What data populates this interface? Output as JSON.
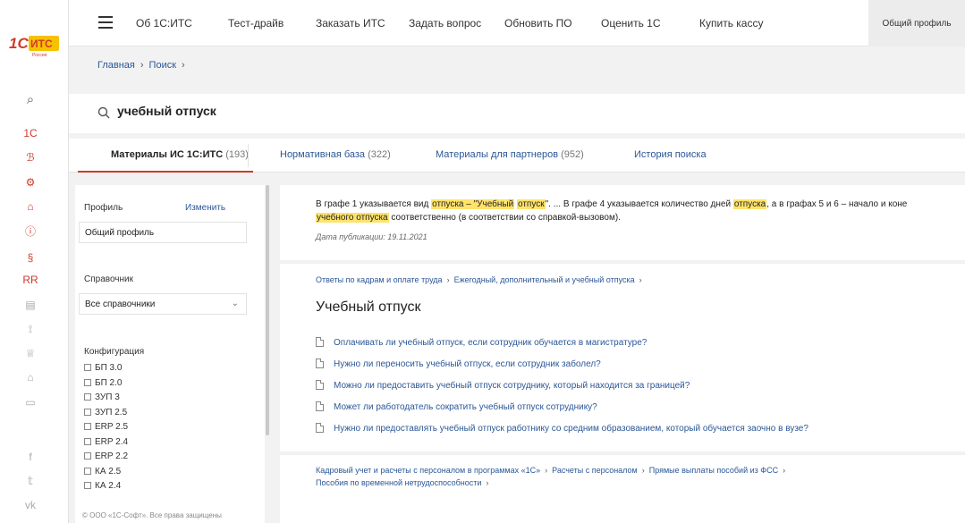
{
  "brand": {
    "logo_text": "1С:ИТС",
    "logo_sub": "Россия",
    "color": "#d03a2c"
  },
  "rail_icons": [
    "search-icon",
    "1c-icon",
    "shield-icon",
    "gears-icon",
    "library-icon",
    "info-icon",
    "paragraph-icon",
    "people-icon",
    "document-icon",
    "megaphone-icon",
    "trophy-icon",
    "graduation-cap-icon",
    "chat-icon",
    "facebook-icon",
    "twitter-icon",
    "vk-icon"
  ],
  "rail_glyphs": [
    "⌕",
    "1С",
    "ℬ",
    "⚙",
    "⌂",
    "ⓘ",
    "§",
    "RR",
    "▤",
    "⟟",
    "♕",
    "⌂",
    "▭",
    "f",
    "𝕥",
    "vk"
  ],
  "topnav": {
    "items": [
      "Об 1С:ИТС",
      "Тест-драйв",
      "Заказать ИТС",
      "Задать вопрос",
      "Обновить ПО",
      "Оценить 1С",
      "Купить кассу"
    ],
    "profile": "Общий профиль"
  },
  "breadcrumb": {
    "home": "Главная",
    "search": "Поиск"
  },
  "search": {
    "query": "учебный отпуск"
  },
  "tabs": [
    {
      "label": "Материалы ИС 1С:ИТС",
      "count": "(193)"
    },
    {
      "label": "Нормативная база",
      "count": "(322)"
    },
    {
      "label": "Материалы для партнеров",
      "count": "(952)"
    },
    {
      "label": "История поиска",
      "count": ""
    }
  ],
  "filters": {
    "profile_label": "Профиль",
    "change_label": "Изменить",
    "profile_value": "Общий профиль",
    "reference_label": "Справочник",
    "reference_value": "Все справочники",
    "config_label": "Конфигурация",
    "configs": [
      "БП 3.0",
      "БП 2.0",
      "ЗУП 3",
      "ЗУП 2.5",
      "ERP 2.5",
      "ERP 2.4",
      "ERP 2.2",
      "КА 2.5",
      "КА 2.4"
    ],
    "footer": "© ООО «1С-Софт». Все права защищены"
  },
  "results": {
    "card1": {
      "s1": "В графе 1 указывается вид ",
      "h1": "отпуска – \"Учебный",
      "s2": " ",
      "h2": "отпуск",
      "s3": "\". ... В графе 4 указывается количество дней ",
      "h3": "отпуска",
      "s4": ", а в графах 5 и 6 – начало и коне",
      "h4": "учебного отпуска",
      "s5": " соответственно (в соответствии со справкой-вызовом).",
      "date": "Дата публикации: 19.11.2021"
    },
    "card2": {
      "crumbs": [
        "Ответы по кадрам и оплате труда",
        "Ежегодный, дополнительный и учебный отпуска"
      ],
      "title": "Учебный отпуск",
      "items": [
        "Оплачивать ли учебный отпуск, если сотрудник обучается в магистратуре?",
        "Нужно ли переносить учебный отпуск, если сотрудник заболел?",
        "Можно ли предоставить учебный отпуск сотруднику, который находится за границей?",
        "Может ли работодатель сократить учебный отпуск сотруднику?",
        "Нужно ли предоставлять учебный отпуск работнику со средним образованием, который обучается заочно в вузе?"
      ]
    },
    "card3": {
      "crumbs": [
        "Кадровый учет и расчеты с персоналом в программах «1С»",
        "Расчеты с персоналом",
        "Прямые выплаты пособий из ФСС"
      ],
      "crumbs2": [
        "Пособия по временной нетрудоспособности"
      ]
    }
  }
}
